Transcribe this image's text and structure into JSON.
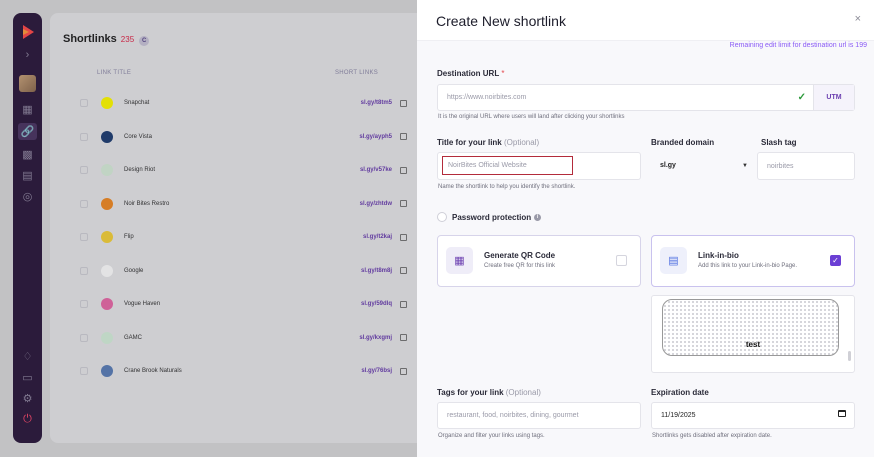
{
  "background_page": {
    "title": "Shortlinks",
    "count": "235",
    "badge": "C",
    "columns": {
      "title": "LINK TITLE",
      "short": "SHORT LINKS"
    },
    "rows": [
      {
        "title": "Snapchat",
        "short": "sl.gy/t8tm5",
        "color": "#fffc00"
      },
      {
        "title": "Core Vista",
        "short": "sl.gy/ayph5",
        "color": "#1f3f73"
      },
      {
        "title": "Design Riot",
        "short": "sl.gy/v57ke",
        "color": "#d8eedb"
      },
      {
        "title": "Noir Bites Restro",
        "short": "sl.gy/zhtdw",
        "color": "#f08a24"
      },
      {
        "title": "Flip",
        "short": "sl.gy/t2kaj",
        "color": "#f5d23a"
      },
      {
        "title": "Google",
        "short": "sl.gy/t8m8j",
        "color": "#ffffff"
      },
      {
        "title": "Vogue Haven",
        "short": "sl.gy/59dlq",
        "color": "#e86aa8"
      },
      {
        "title": "GAMC",
        "short": "sl.gy/kxgmj",
        "color": "#d6f0dc"
      },
      {
        "title": "Crane Brook Naturals",
        "short": "sl.gy/76bsj",
        "color": "#5b7fb8"
      }
    ]
  },
  "modal": {
    "title": "Create New shortlink",
    "close": "×",
    "edit_limit": "Remaining edit limit for destination url is 199",
    "destination": {
      "label": "Destination URL",
      "required": "*",
      "placeholder": "https://www.noirbites.com",
      "utm": "UTM",
      "hint": "It is the original URL where users will land after clicking your shortlinks"
    },
    "title_field": {
      "label": "Title for your link",
      "optional": "(Optional)",
      "placeholder": "NoirBites Official Website",
      "hint": "Name the shortlink to help you identify the shortlink."
    },
    "branded_domain": {
      "label": "Branded domain",
      "value": "sl.gy"
    },
    "slash_tag": {
      "label": "Slash tag",
      "placeholder": "noirbites"
    },
    "password": {
      "label": "Password protection"
    },
    "qr": {
      "title": "Generate QR Code",
      "subtitle": "Create free QR for this link",
      "checked": false
    },
    "bio": {
      "title": "Link-in-bio",
      "subtitle": "Add this link to your Link-in-bio Page.",
      "checked": true
    },
    "preview": {
      "text": "test"
    },
    "tags": {
      "label": "Tags for your link",
      "optional": "(Optional)",
      "placeholder": "restaurant, food, noirbites, dining, gourmet",
      "hint": "Organize and filter your links using tags."
    },
    "expiration": {
      "label": "Expiration date",
      "value": "11/19/2025",
      "hint": "Shortlinks gets disabled after expiration  date."
    }
  },
  "colors": {
    "accent": "#6b3fd4",
    "sidebar": "#2c1a3d",
    "error": "#e5484d",
    "success": "#2d9a3b"
  }
}
